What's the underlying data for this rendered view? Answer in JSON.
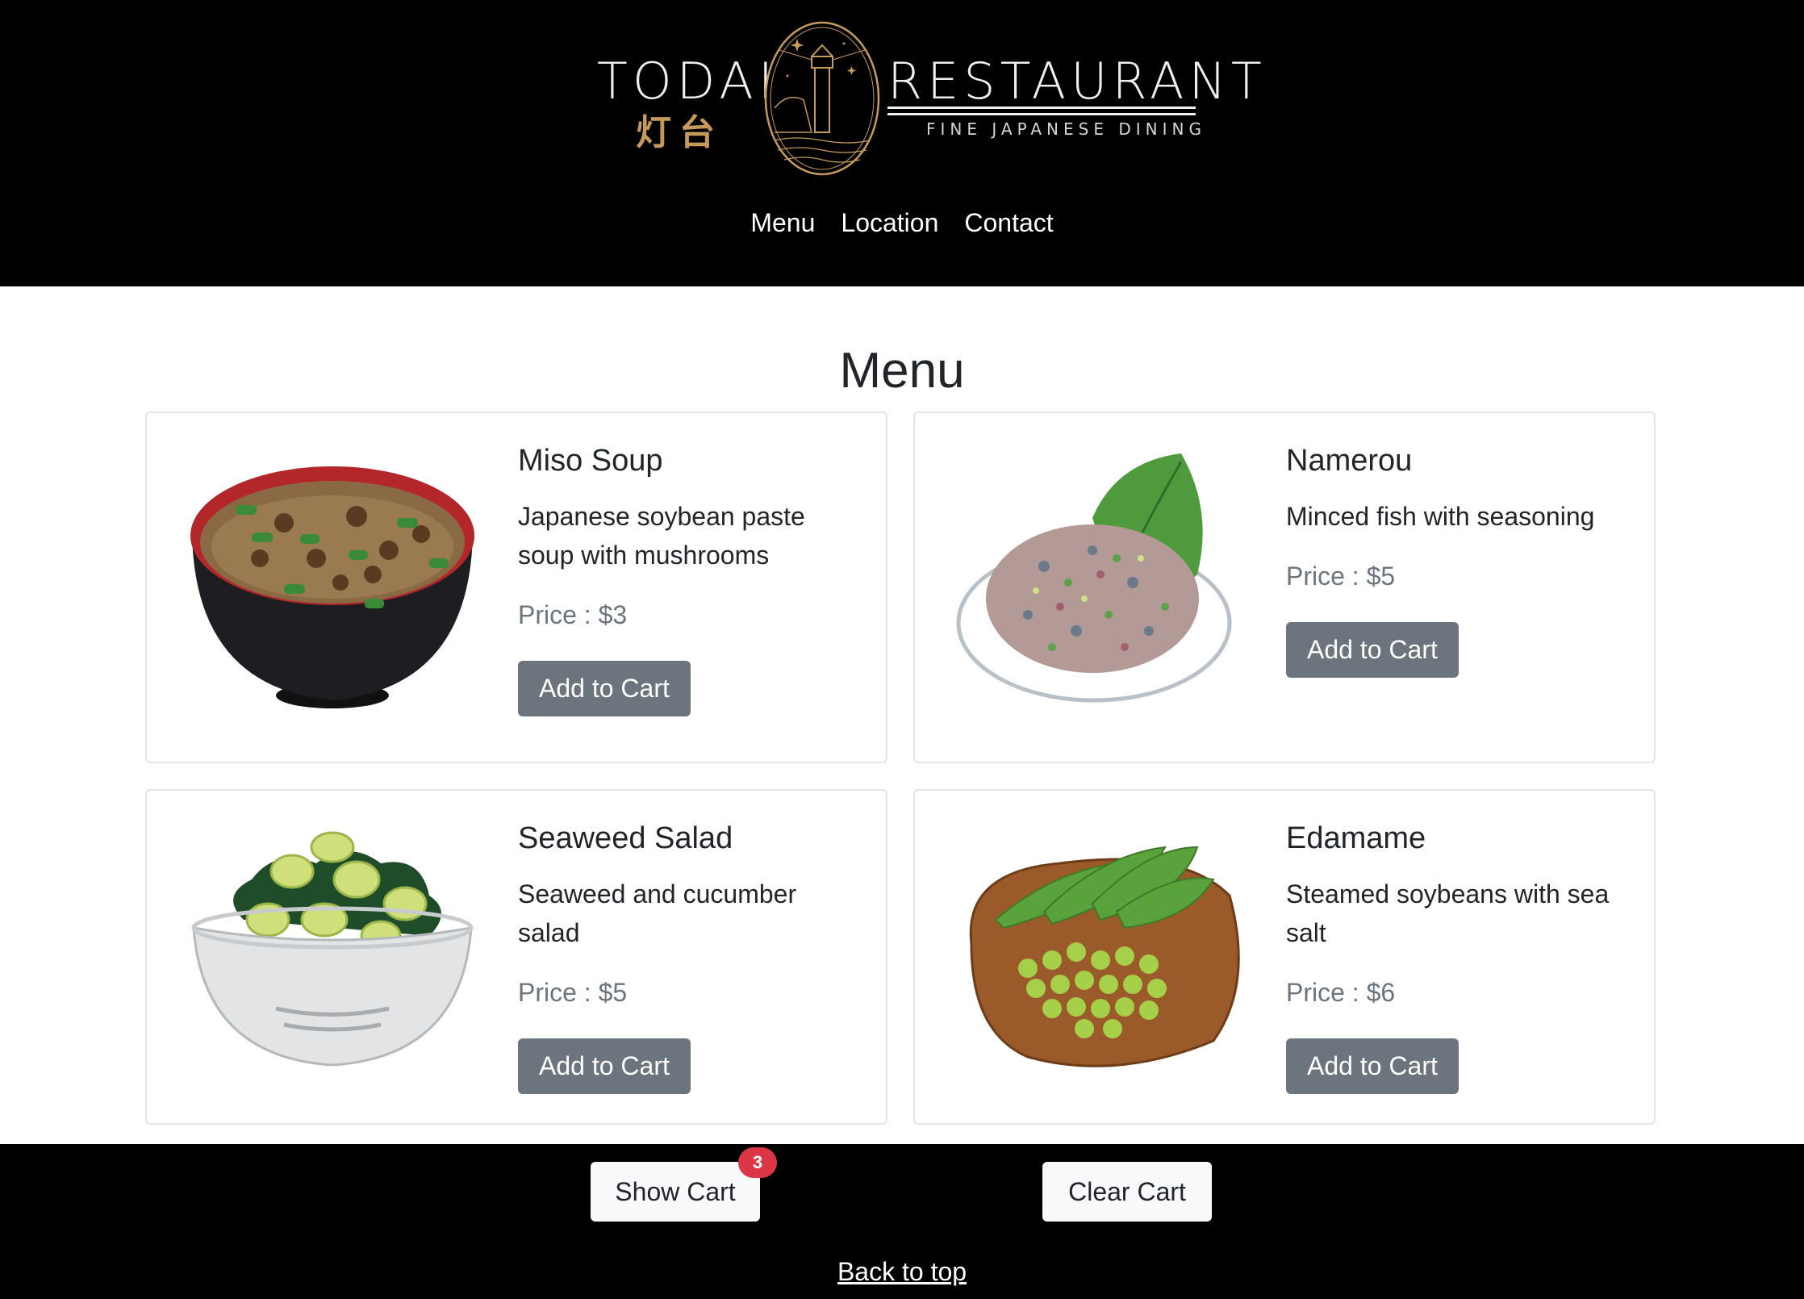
{
  "brand": {
    "name_left": "TODAI",
    "name_kanji": "灯台",
    "name_right": "RESTAURANT",
    "tagline": "FINE JAPANESE DINING",
    "accent_color": "#c59a5a"
  },
  "nav": {
    "items": [
      "Menu",
      "Location",
      "Contact"
    ]
  },
  "menu": {
    "title": "Menu",
    "items": [
      {
        "name": "Miso Soup",
        "description": "Japanese soybean paste soup with mushrooms",
        "price": "Price : $3",
        "button": "Add to Cart",
        "image": "miso-soup-illustration"
      },
      {
        "name": "Namerou",
        "description": "Minced fish with seasoning",
        "price": "Price : $5",
        "button": "Add to Cart",
        "image": "namerou-illustration"
      },
      {
        "name": "Seaweed Salad",
        "description": "Seaweed and cucumber salad",
        "price": "Price : $5",
        "button": "Add to Cart",
        "image": "seaweed-salad-illustration"
      },
      {
        "name": "Edamame",
        "description": "Steamed soybeans with sea salt",
        "price": "Price : $6",
        "button": "Add to Cart",
        "image": "edamame-illustration"
      }
    ]
  },
  "footer": {
    "show_cart": "Show Cart",
    "cart_count": "3",
    "clear_cart": "Clear Cart",
    "back_to_top": "Back to top"
  },
  "colors": {
    "header_bg": "#000000",
    "button_secondary": "#6c757d",
    "badge": "#dc3545"
  }
}
